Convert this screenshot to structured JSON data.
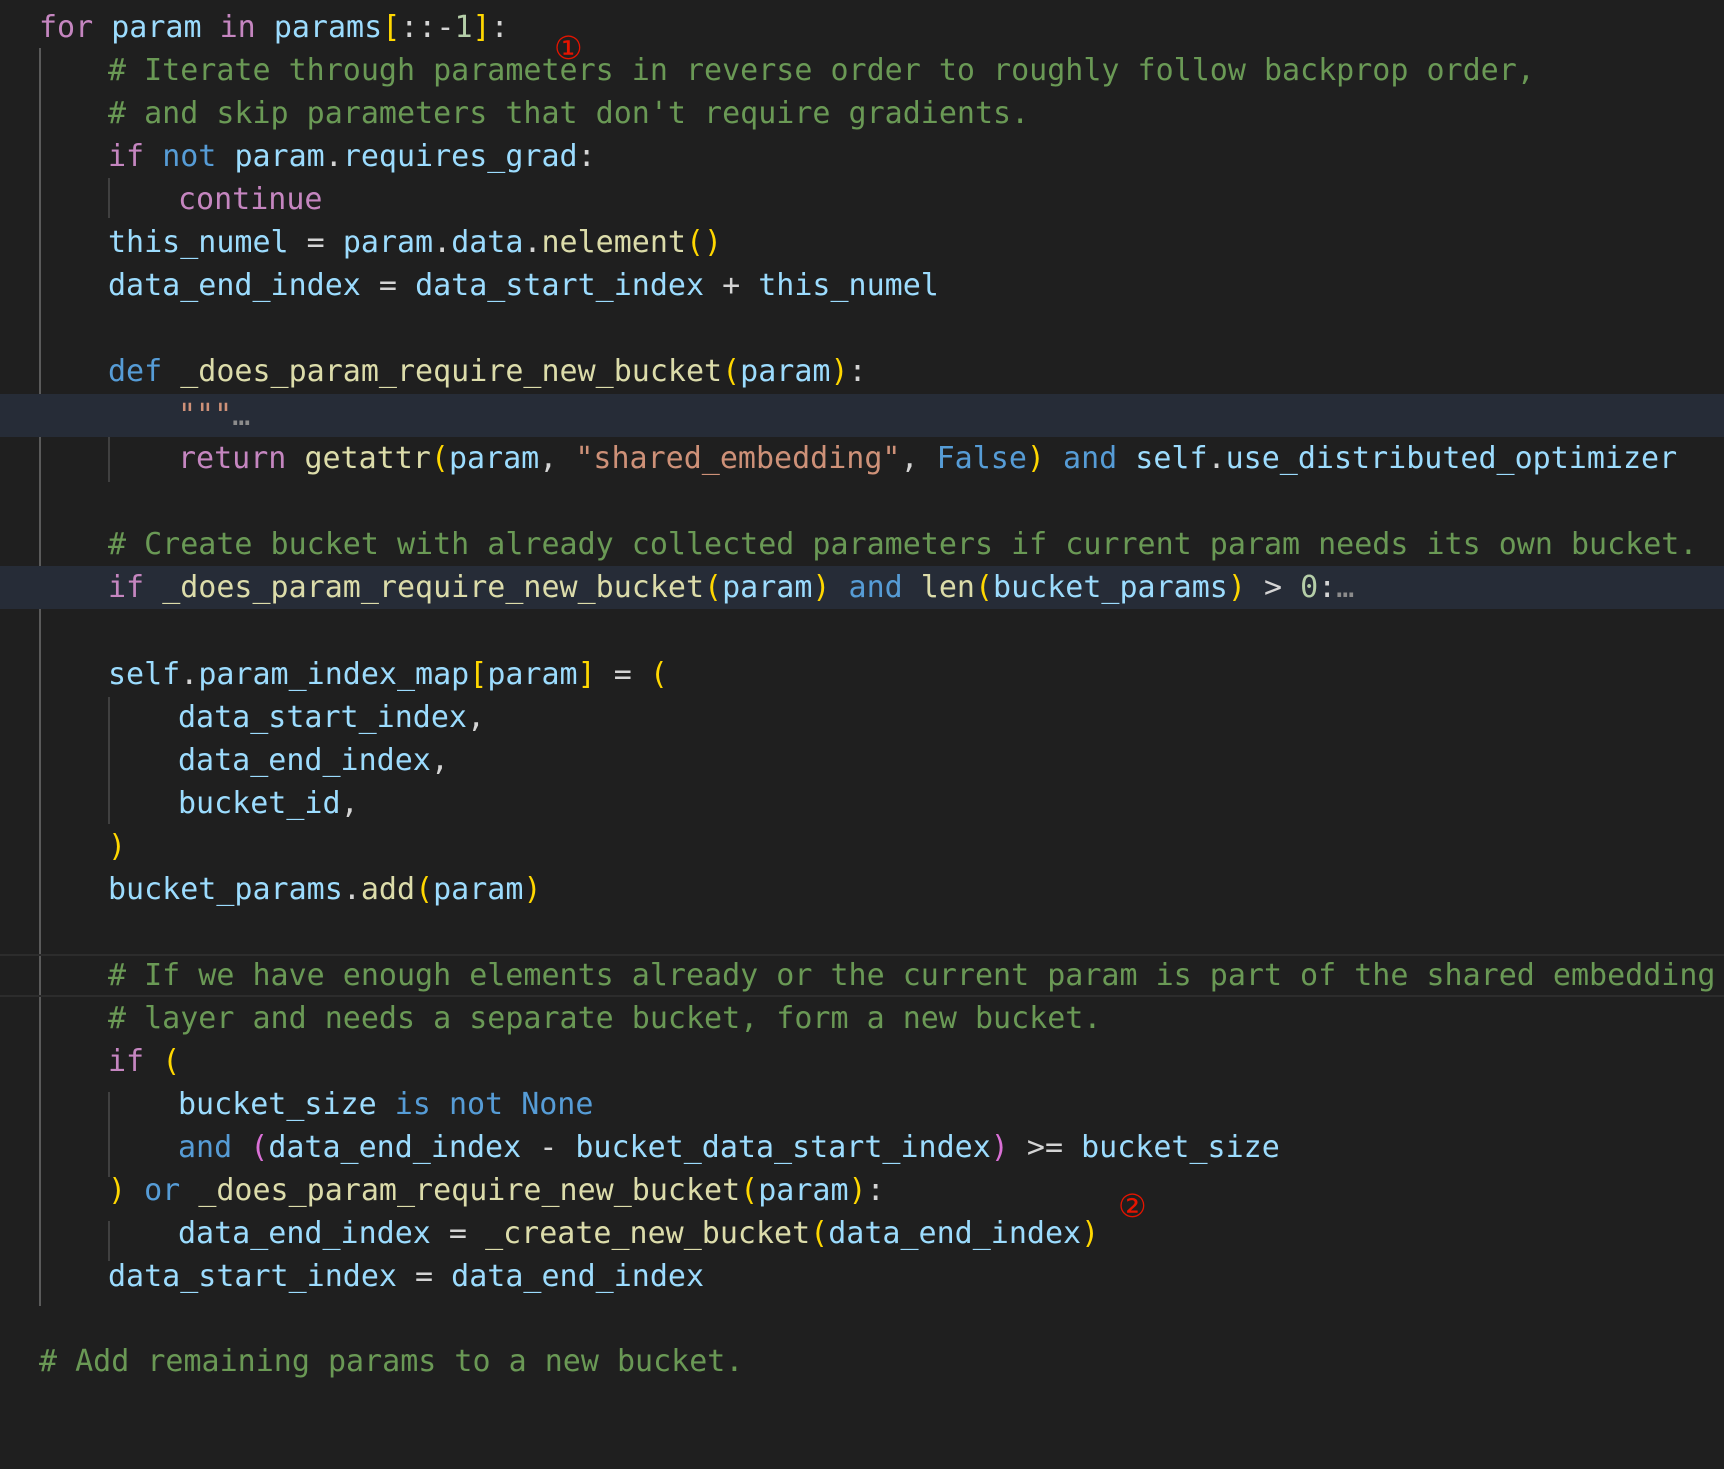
{
  "editor": {
    "lines": [
      "for param in params[::-1]:",
      "# Iterate through parameters in reverse order to roughly follow backprop order,",
      "# and skip parameters that don't require gradients.",
      "if not param.requires_grad:",
      "continue",
      "this_numel = param.data.nelement()",
      "data_end_index = data_start_index + this_numel",
      "",
      "def _does_param_require_new_bucket(param):",
      "\"\"\"…",
      "return getattr(param, \"shared_embedding\", False) and self.use_distributed_optimizer",
      "",
      "# Create bucket with already collected parameters if current param needs its own bucket.",
      "if _does_param_require_new_bucket(param) and len(bucket_params) > 0:…",
      "",
      "self.param_index_map[param] = (",
      "data_start_index,",
      "data_end_index,",
      "bucket_id,",
      ")",
      "bucket_params.add(param)",
      "",
      "# If we have enough elements already or the current param is part of the shared embedding",
      "# layer and needs a separate bucket, form a new bucket.",
      "if (",
      "bucket_size is not None",
      "and (data_end_index - bucket_data_start_index) >= bucket_size",
      ") or _does_param_require_new_bucket(param):",
      "data_end_index = _create_new_bucket(data_end_index)",
      "data_start_index = data_end_index",
      "",
      "# Add remaining params to a new bucket."
    ]
  },
  "annotations": {
    "marker_1": "①",
    "marker_2": "②"
  },
  "colors": {
    "background": "#1f1f1f",
    "keyword_control": "#c586c0",
    "keyword": "#569cd6",
    "variable": "#9cdcfe",
    "function": "#dcdcaa",
    "string": "#ce9178",
    "number": "#b5cea8",
    "comment": "#6a9955",
    "bracket_1": "#ffd700",
    "bracket_2": "#da70d6",
    "annotation": "#e51400"
  }
}
